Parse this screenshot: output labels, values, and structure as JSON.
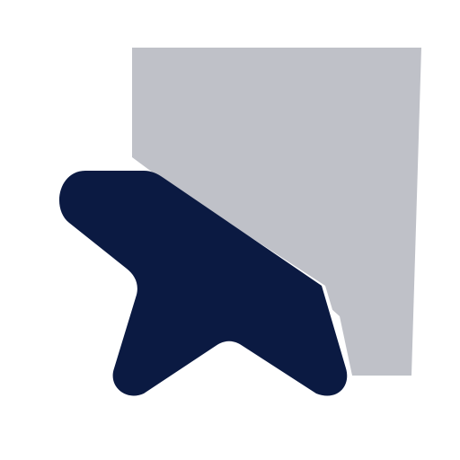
{
  "colors": {
    "background": "#ffffff",
    "panel": "#bfc1c8",
    "star": "#0b1a42",
    "gap": "#ffffff"
  },
  "icons": {
    "logo": "star-over-panel-logo"
  }
}
